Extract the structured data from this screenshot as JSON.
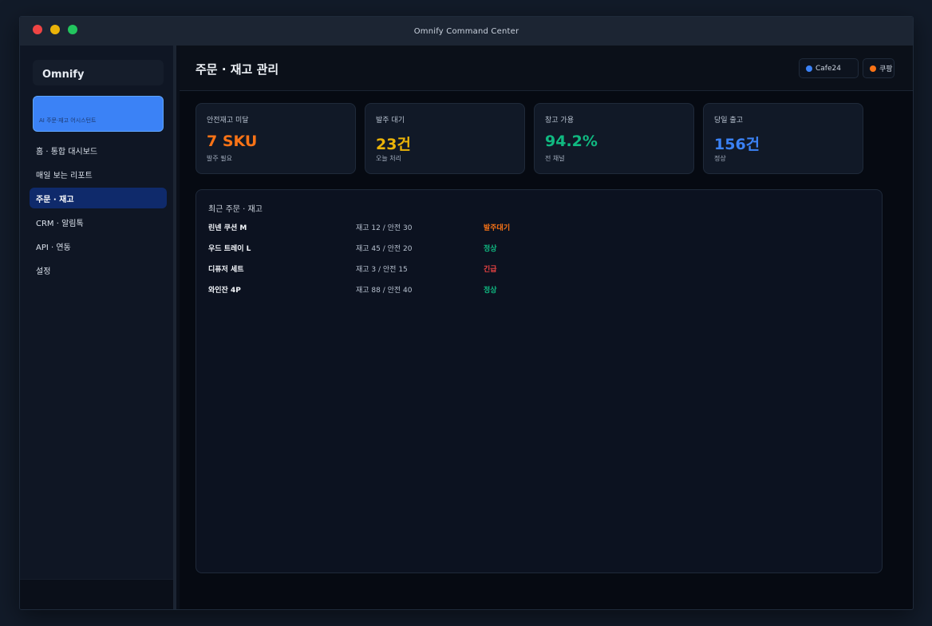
{
  "window": {
    "title": "Omnify Command Center"
  },
  "sidebar": {
    "brand": "Omnify",
    "workspace_label": "AI 주문·재고 어시스턴트",
    "items": [
      {
        "label": "홈 · 통합 대시보드"
      },
      {
        "label": "매일 보는 리포트"
      },
      {
        "label": "주문 · 재고"
      },
      {
        "label": "CRM · 알림톡"
      },
      {
        "label": "API · 연동"
      },
      {
        "label": "설정"
      }
    ]
  },
  "header": {
    "title": "주문 · 재고 관리",
    "channels": [
      {
        "label": "Cafe24",
        "color": "#3b82f6"
      },
      {
        "label": "쿠팡",
        "color": "#f97316"
      }
    ]
  },
  "kpis": [
    {
      "title": "안전재고 미달",
      "value": "7 SKU",
      "sub": "발주 필요",
      "color": "#f97316"
    },
    {
      "title": "발주 대기",
      "value": "23건",
      "sub": "오늘 처리",
      "color": "#eab308"
    },
    {
      "title": "창고 가용",
      "value": "94.2%",
      "sub": "전 채널",
      "color": "#10b981"
    },
    {
      "title": "당일 출고",
      "value": "156건",
      "sub": "정상",
      "color": "#3b82f6"
    }
  ],
  "panel": {
    "title": "최근 주문 · 재고",
    "rows": [
      {
        "name": "린넨 쿠션 M",
        "stock": "재고 12 / 안전 30",
        "status": "발주대기",
        "color": "#f97316"
      },
      {
        "name": "우드 트레이 L",
        "stock": "재고 45 / 안전 20",
        "status": "정상",
        "color": "#10b981"
      },
      {
        "name": "디퓨저 세트",
        "stock": "재고 3 / 안전 15",
        "status": "긴급",
        "color": "#ef4444"
      },
      {
        "name": "와인잔 4P",
        "stock": "재고 88 / 안전 40",
        "status": "정상",
        "color": "#10b981"
      }
    ]
  }
}
